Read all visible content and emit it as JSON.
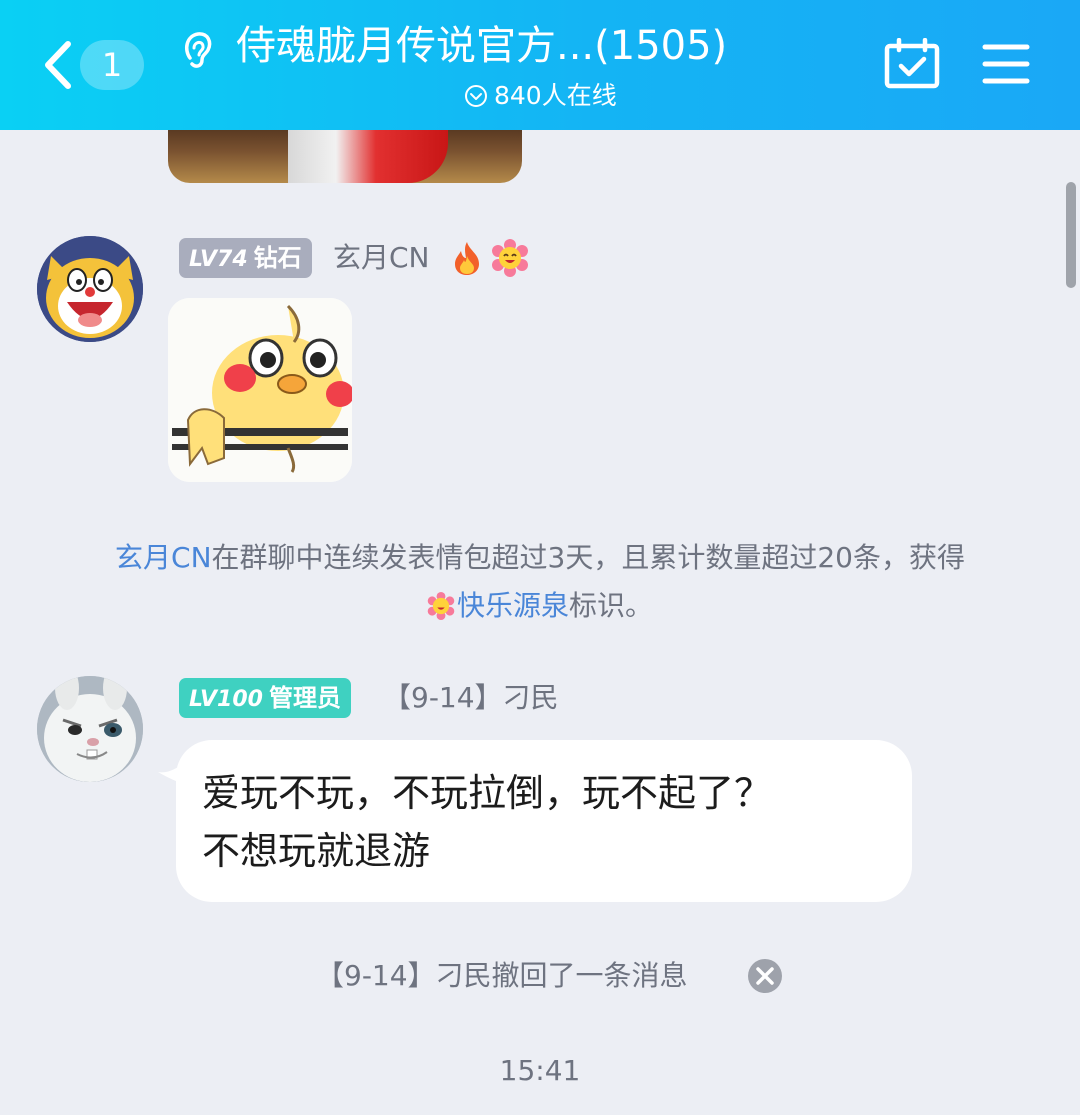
{
  "header": {
    "unread_count": "1",
    "title": "侍魂胧月传说官方...(1505)",
    "online_status": "840人在线",
    "colors": {
      "gradient_start": "#0ad0f4",
      "gradient_end": "#1aa8f6"
    }
  },
  "messages": [
    {
      "type": "sticker",
      "level_tag": "LV74",
      "role": "钻石",
      "sender": "玄月CN",
      "badges": [
        "fire-icon",
        "flower-icon"
      ]
    },
    {
      "type": "text",
      "level_tag": "LV100",
      "role": "管理员",
      "sender": "【9-14】刁民",
      "text": "爱玩不玩，不玩拉倒，玩不起了？\n不想玩就退游"
    }
  ],
  "system": {
    "user_link": "玄月CN",
    "text_main": "在群聊中连续发表情包超过3天，且累计数量超过20条，获得",
    "badge_link": "快乐源泉",
    "text_suffix": "标识。"
  },
  "recall": {
    "text": "【9-14】刁民撤回了一条消息"
  },
  "timestamp": "15:41"
}
